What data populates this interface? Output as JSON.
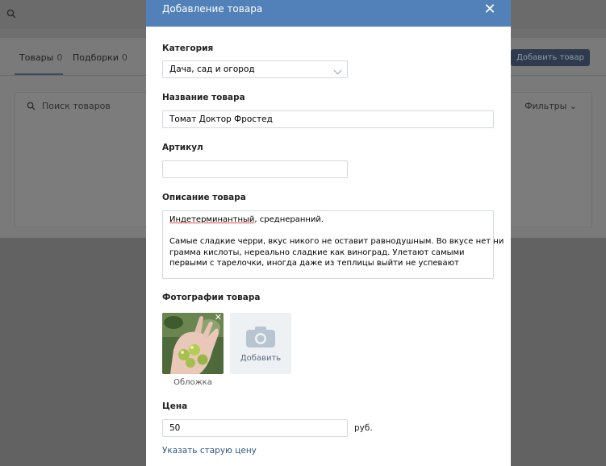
{
  "background": {
    "tabs": [
      {
        "label": "Товары",
        "count": "0"
      },
      {
        "label": "Подборки",
        "count": "0"
      }
    ],
    "add_button": "Добавить товар",
    "search_placeholder": "Поиск товаров",
    "filters": "Фильтры"
  },
  "modal": {
    "title": "Добавление товара",
    "category": {
      "label": "Категория",
      "value": "Дача, сад и огород"
    },
    "name": {
      "label": "Название товара",
      "value": "Томат Доктор Фростед"
    },
    "sku": {
      "label": "Артикул",
      "value": ""
    },
    "description": {
      "label": "Описание товара",
      "line1_a": "Индетерминантный",
      "line1_b": ", среднеранний.",
      "line2": "",
      "line3": "Самые сладкие черри, вкус никого не оставит равнодушным. Во вкусе нет ни",
      "line4": "грамма кислоты, нереально сладкие как виноград. Улетают самыми",
      "line5": "первыми с тарелочки, иногда даже из теплицы выйти не успевают"
    },
    "photos": {
      "label": "Фотографии товара",
      "cover_caption": "Обложка",
      "add_label": "Добавить"
    },
    "price": {
      "label": "Цена",
      "value": "50",
      "unit": "руб."
    },
    "old_price_link": "Указать старую цену"
  },
  "colors": {
    "header": "#5181b8",
    "link": "#2a5885"
  },
  "icons": [
    "search-icon",
    "chevron-down-icon",
    "close-icon",
    "camera-icon",
    "remove-photo-icon"
  ]
}
